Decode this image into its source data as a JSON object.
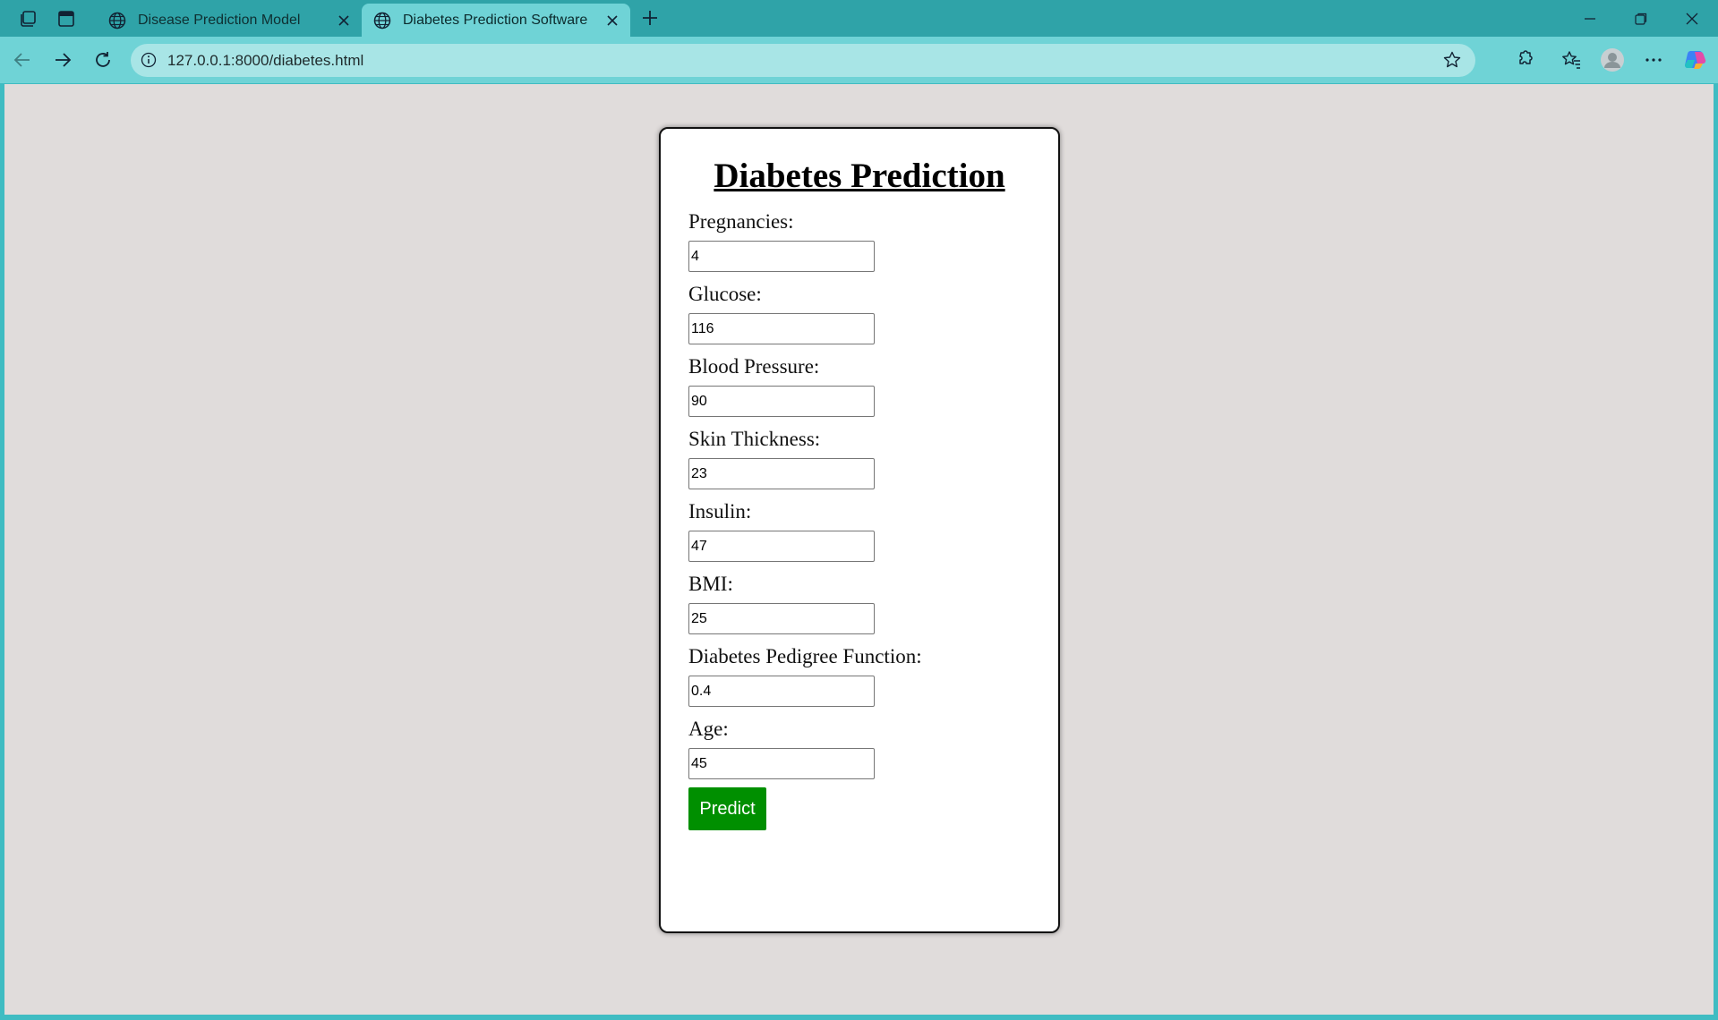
{
  "browser": {
    "tabs": [
      {
        "title": "Disease Prediction Model",
        "active": false
      },
      {
        "title": "Diabetes Prediction Software",
        "active": true
      }
    ],
    "url": "127.0.0.1:8000/diabetes.html",
    "colors": {
      "tabstrip": "#2fa3a8",
      "toolbar": "#6fd3d6",
      "address_bar": "#a8e5e6"
    },
    "icons": [
      "workspaces-icon",
      "tab-actions-icon",
      "globe-icon",
      "close-icon",
      "new-tab-icon",
      "minimize-icon",
      "restore-icon",
      "window-close-icon",
      "back-icon",
      "forward-icon",
      "refresh-icon",
      "site-info-icon",
      "favorite-star-icon",
      "extensions-icon",
      "favorites-icon",
      "profile-icon",
      "more-icon",
      "copilot-icon"
    ]
  },
  "page": {
    "title": "Diabetes Prediction",
    "background": "#e0dcdb",
    "fields": [
      {
        "label": "Pregnancies:",
        "value": "4"
      },
      {
        "label": "Glucose:",
        "value": "116"
      },
      {
        "label": "Blood Pressure:",
        "value": "90"
      },
      {
        "label": "Skin Thickness:",
        "value": "23"
      },
      {
        "label": "Insulin:",
        "value": "47"
      },
      {
        "label": "BMI:",
        "value": "25"
      },
      {
        "label": "Diabetes Pedigree Function:",
        "value": "0.4"
      },
      {
        "label": "Age:",
        "value": "45"
      }
    ],
    "predict_label": "Predict",
    "predict_color": "#008f00"
  }
}
